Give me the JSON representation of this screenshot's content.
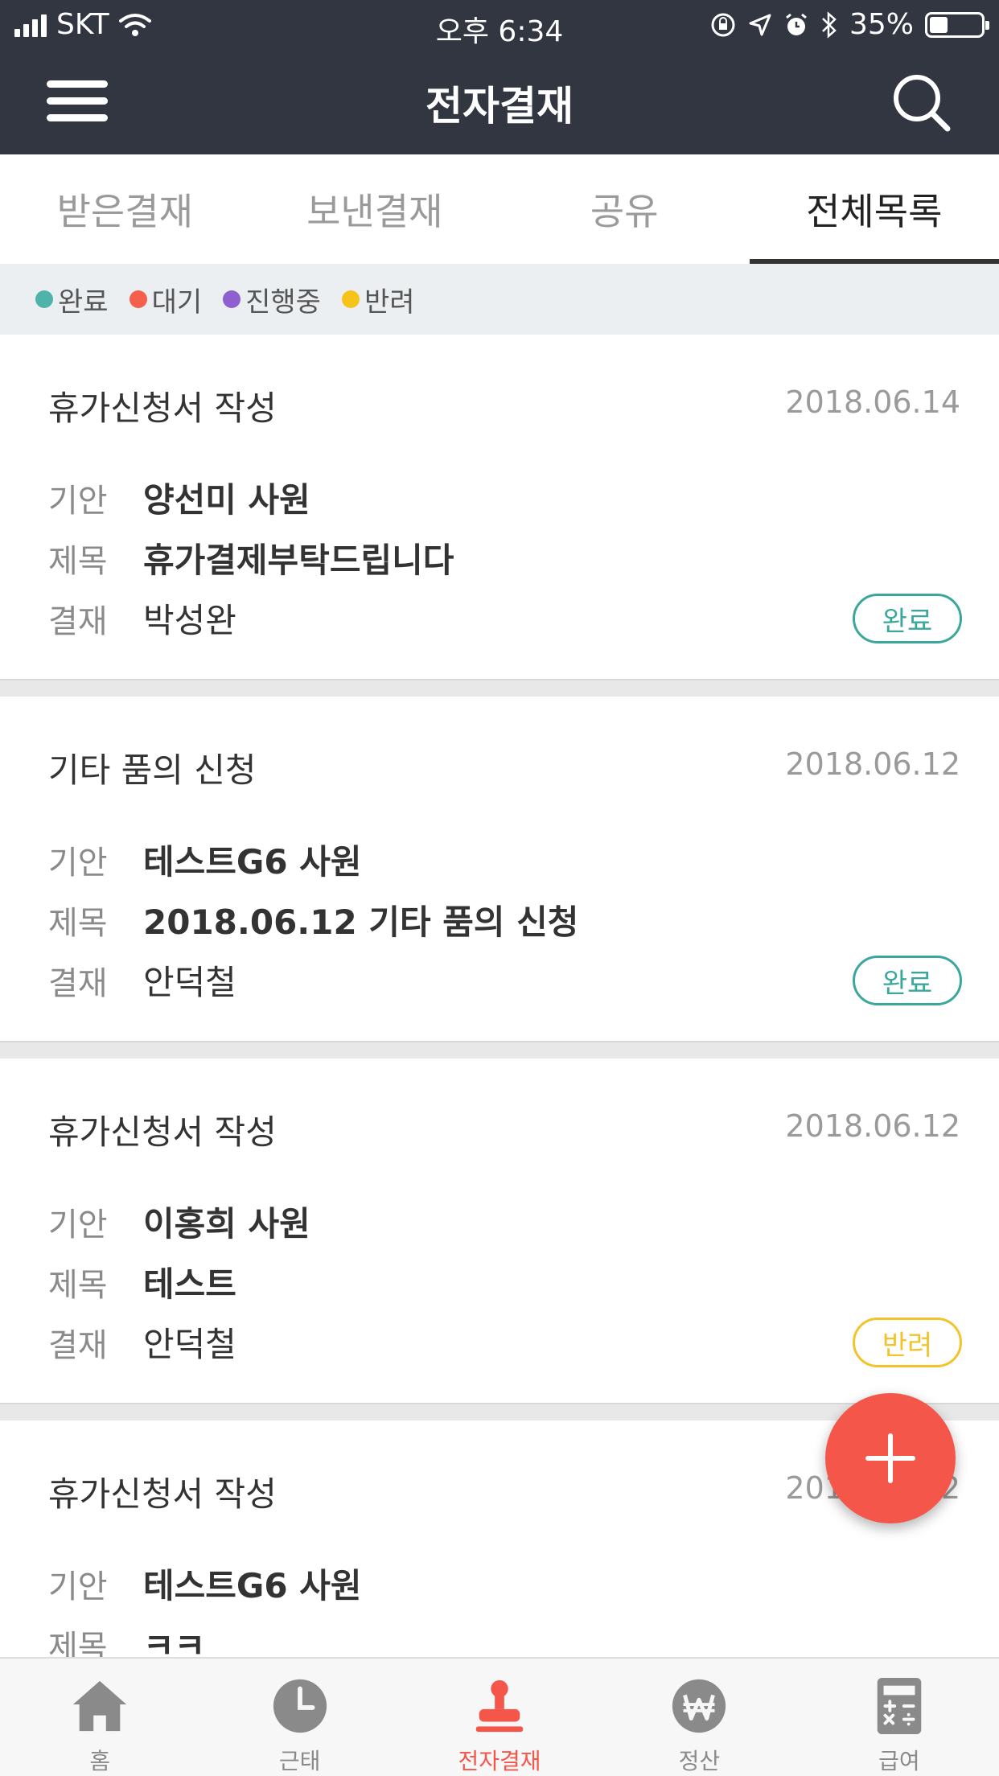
{
  "status_bar": {
    "carrier": "SKT",
    "time": "오후 6:34",
    "battery": "35%",
    "battery_level": 0.35
  },
  "app_bar": {
    "title": "전자결재",
    "menu_icon": "hamburger-menu-icon",
    "search_icon": "search-icon"
  },
  "tabs": [
    {
      "label": "받은결재",
      "active": false
    },
    {
      "label": "보낸결재",
      "active": false
    },
    {
      "label": "공유",
      "active": false
    },
    {
      "label": "전체목록",
      "active": true
    }
  ],
  "legend": [
    {
      "label": "완료",
      "color": "#4fb3aa"
    },
    {
      "label": "대기",
      "color": "#f5604c"
    },
    {
      "label": "진행중",
      "color": "#8f5fcf"
    },
    {
      "label": "반려",
      "color": "#f6c21c"
    }
  ],
  "field_labels": {
    "drafter": "기안",
    "subject": "제목",
    "approver": "결재"
  },
  "cards": [
    {
      "title": "휴가신청서 작성",
      "date": "2018.06.14",
      "drafter": "양선미 사원",
      "subject": "휴가결제부탁드립니다",
      "approver": "박성완",
      "status": "완료",
      "status_color": "#3aa79b"
    },
    {
      "title": "기타 품의 신청",
      "date": "2018.06.12",
      "drafter": "테스트G6 사원",
      "subject": "2018.06.12 기타 품의 신청",
      "approver": "안덕철",
      "status": "완료",
      "status_color": "#3aa79b"
    },
    {
      "title": "휴가신청서 작성",
      "date": "2018.06.12",
      "drafter": "이홍희 사원",
      "subject": "테스트",
      "approver": "안덕철",
      "status": "반려",
      "status_color": "#f2c32a"
    },
    {
      "title": "휴가신청서 작성",
      "date": "2018.06.12",
      "drafter": "테스트G6 사원",
      "subject": "ㅋㅋ",
      "approver": "",
      "status": "",
      "status_color": ""
    }
  ],
  "fab_icon": "plus-icon",
  "bottom_nav": [
    {
      "label": "홈",
      "icon": "home-icon",
      "active": false
    },
    {
      "label": "근태",
      "icon": "clock-icon",
      "active": false
    },
    {
      "label": "전자결재",
      "icon": "stamp-icon",
      "active": true
    },
    {
      "label": "정산",
      "icon": "won-coin-icon",
      "active": false
    },
    {
      "label": "급여",
      "icon": "calculator-icon",
      "active": false
    }
  ],
  "colors": {
    "header": "#323641",
    "accent": "#f5564a",
    "legend_bg": "#eceff1"
  }
}
